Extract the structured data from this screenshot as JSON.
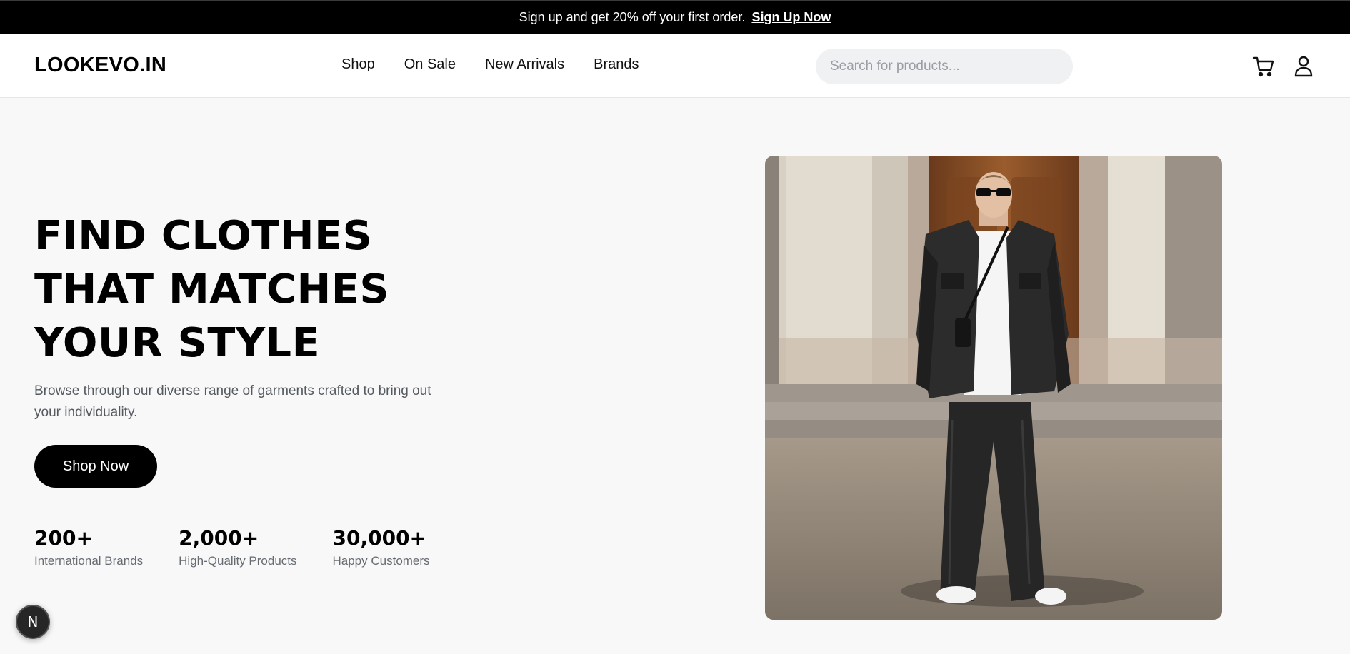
{
  "banner": {
    "text": "Sign up and get 20% off your first order.",
    "cta": "Sign Up Now"
  },
  "nav": {
    "logo": "LOOKEVO.IN",
    "links": [
      "Shop",
      "On Sale",
      "New Arrivals",
      "Brands"
    ],
    "search_placeholder": "Search for products...",
    "icons": [
      "cart-icon",
      "user-icon"
    ]
  },
  "hero": {
    "title_lines": [
      "FIND CLOTHES",
      "THAT MATCHES",
      "YOUR STYLE"
    ],
    "subtitle": "Browse through our diverse range of garments crafted to bring out your individuality.",
    "button": "Shop Now",
    "stats": [
      {
        "value": "200+",
        "label": "International Brands"
      },
      {
        "value": "2,000+",
        "label": "High-Quality Products"
      },
      {
        "value": "30,000+",
        "label": "Happy Customers"
      }
    ]
  },
  "dev_badge": {
    "label": "N"
  },
  "colors": {
    "primary": "#000000",
    "page_background": "#f8f8f8",
    "search_background": "#f0f1f3",
    "muted_text": "#555a60"
  }
}
